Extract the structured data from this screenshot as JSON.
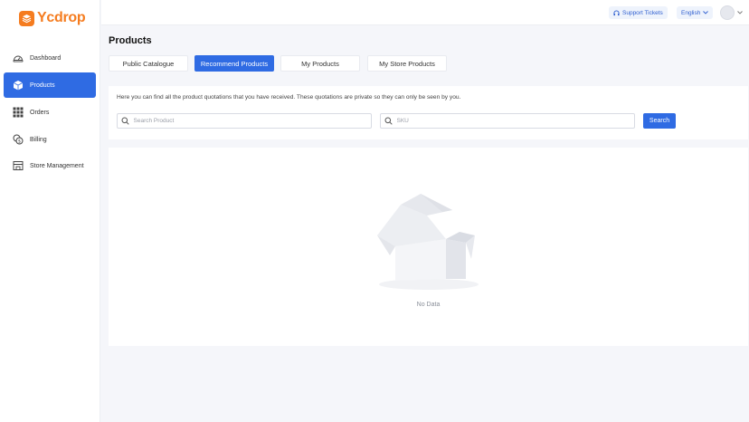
{
  "app": {
    "logo_text": "Ycdrop",
    "brand_color": "#f57c1f",
    "accent_color": "#2f6be3"
  },
  "sidebar": {
    "items": [
      {
        "label": "Dashboard",
        "icon": "dashboard-icon",
        "active": false
      },
      {
        "label": "Products",
        "icon": "box-icon",
        "active": true
      },
      {
        "label": "Orders",
        "icon": "grid-icon",
        "active": false
      },
      {
        "label": "Billing",
        "icon": "coins-icon",
        "active": false
      },
      {
        "label": "Store Management",
        "icon": "store-icon",
        "active": false
      }
    ]
  },
  "header": {
    "support_label": "Support Tickets",
    "language_label": "English"
  },
  "page": {
    "title": "Products",
    "tabs": [
      {
        "label": "Public Catalogue",
        "active": false
      },
      {
        "label": "Recommend Products",
        "active": true
      },
      {
        "label": "My Products",
        "active": false
      },
      {
        "label": "My Store Products",
        "active": false
      }
    ],
    "description": "Here you can find all the product quotations that you have received. These quotations are private so they can only be seen by you.",
    "search_product_placeholder": "Search Product",
    "sku_placeholder": "SKU",
    "search_button": "Search",
    "empty_text": "No Data"
  }
}
